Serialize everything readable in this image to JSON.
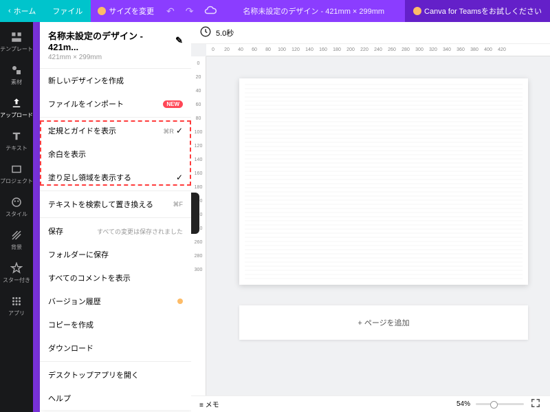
{
  "topbar": {
    "home": "ホーム",
    "file": "ファイル",
    "resize": "サイズを変更",
    "title": "名称未設定のデザイン - 421mm × 299mm",
    "teams": "Canva for Teamsをお試しください"
  },
  "sidebar": {
    "items": [
      {
        "label": "テンプレート"
      },
      {
        "label": "素材"
      },
      {
        "label": "アップロード"
      },
      {
        "label": "テキスト"
      },
      {
        "label": "プロジェクト"
      },
      {
        "label": "スタイル"
      },
      {
        "label": "背景"
      },
      {
        "label": "スター付き"
      },
      {
        "label": "アプリ"
      }
    ]
  },
  "dropdown": {
    "title": "名称未設定のデザイン - 421m...",
    "subtitle": "421mm × 299mm",
    "items": {
      "new_design": "新しいデザインを作成",
      "import": "ファイルをインポート",
      "import_badge": "NEW",
      "rulers": "定規とガイドを表示",
      "rulers_shortcut": "⌘R",
      "margins": "余白を表示",
      "bleed": "塗り足し領域を表示する",
      "find_replace": "テキストを検索して置き換える",
      "find_shortcut": "⌘F",
      "save": "保存",
      "save_msg": "すべての変更は保存されました",
      "save_folder": "フォルダーに保存",
      "comments": "すべてのコメントを表示",
      "version": "バージョン履歴",
      "copy": "コピーを作成",
      "download": "ダウンロード",
      "desktop": "デスクトップアプリを開く",
      "help": "ヘルプ"
    }
  },
  "toolbar": {
    "duration": "5.0秒"
  },
  "ruler_h": [
    "0",
    "20",
    "40",
    "60",
    "80",
    "100",
    "120",
    "140",
    "160",
    "180",
    "200",
    "220",
    "240",
    "260",
    "280",
    "300",
    "320",
    "340",
    "360",
    "380",
    "400",
    "420"
  ],
  "ruler_v": [
    "0",
    "20",
    "40",
    "60",
    "80",
    "100",
    "120",
    "140",
    "160",
    "180",
    "200",
    "220",
    "240",
    "260",
    "280",
    "300"
  ],
  "canvas": {
    "add_page": "+ ページを追加"
  },
  "bottom": {
    "notes": "メモ",
    "zoom": "54%"
  }
}
